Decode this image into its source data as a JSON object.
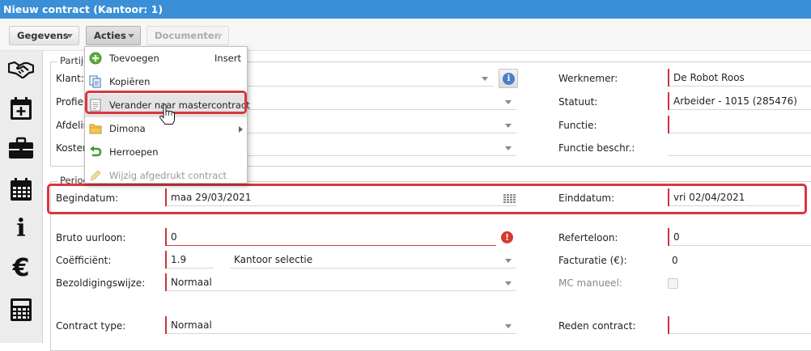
{
  "window": {
    "title": "Nieuw contract (Kantoor: 1)"
  },
  "toolbar": {
    "gegevens": "Gegevens",
    "acties": "Acties",
    "documenten": "Documenten"
  },
  "sidebar": {
    "icons": [
      "handshake-icon",
      "calendar-add-icon",
      "briefcase-icon",
      "calendar-icon",
      "info-icon",
      "euro-icon",
      "calculator-icon"
    ],
    "info_glyph": "i",
    "euro_glyph": "€"
  },
  "partijen": {
    "legend": "Partije",
    "klant_label": "Klant:",
    "profiel_label": "Profiel:",
    "afdeling_label": "Afdelin",
    "kosten_label": "Kosten",
    "werknemer_label": "Werknemer:",
    "werknemer_value": "De Robot Roos",
    "statuut_label": "Statuut:",
    "statuut_value": "Arbeider - 1015 (285476)",
    "functie_label": "Functie:",
    "functie_value": "",
    "functie_beschr_label": "Functie beschr.:",
    "functie_beschr_value": ""
  },
  "periode": {
    "legend": "Period",
    "begindatum_label": "Begindatum:",
    "begindatum_value": "maa 29/03/2021",
    "einddatum_label": "Einddatum:",
    "einddatum_value": "vri 02/04/2021"
  },
  "loon": {
    "bruto_label": "Bruto uurloon:",
    "bruto_value": "0",
    "error_glyph": "!",
    "coef_label": "Coëfficiënt:",
    "coef_value": "1.9",
    "kantoor_value": "Kantoor selectie",
    "bezold_label": "Bezoldigingswijze:",
    "bezold_value": "Normaal",
    "referteloon_label": "Referteloon:",
    "referteloon_value": "0",
    "facturatie_label": "Facturatie (€):",
    "facturatie_value": "0",
    "mc_label": "MC manueel:",
    "mc_checked": false
  },
  "contract": {
    "type_label": "Contract type:",
    "type_value": "Normaal",
    "reden_label": "Reden contract:",
    "reden_value": ""
  },
  "menu": {
    "items": [
      {
        "label": "Toevoegen",
        "shortcut": "Insert",
        "icon": "add-icon",
        "enabled": true
      },
      {
        "label": "Kopiëren",
        "shortcut": "",
        "icon": "copy-icon",
        "enabled": true
      },
      {
        "label": "Verander naar mastercontract",
        "shortcut": "",
        "icon": "document-icon",
        "enabled": true,
        "hovered": true
      },
      {
        "label": "Dimona",
        "shortcut": "",
        "icon": "folder-icon",
        "enabled": true,
        "submenu": true
      },
      {
        "label": "Herroepen",
        "shortcut": "",
        "icon": "undo-icon",
        "enabled": true
      },
      {
        "label": "Wijzig afgedrukt contract",
        "shortcut": "",
        "icon": "pencil-icon",
        "enabled": false
      }
    ]
  },
  "colors": {
    "title_bar": "#3a8fd6",
    "required_marker": "#c8343a",
    "highlight": "#d9363e"
  }
}
